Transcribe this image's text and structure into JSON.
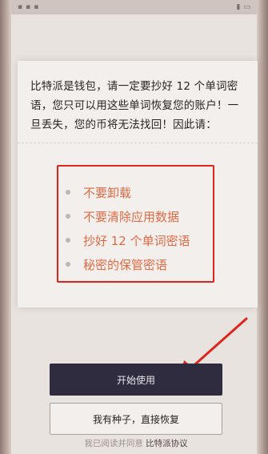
{
  "intro": {
    "text": "比特派是钱包，请一定要抄好 12 个单词密语，您只可以用这些单词恢复您的账户！一旦丢失，您的币将无法找回！因此请："
  },
  "tips": [
    "不要卸载",
    "不要清除应用数据",
    "抄好 12 个单词密语",
    "秘密的保管密语"
  ],
  "buttons": {
    "start": "开始使用",
    "restore": "我有种子，直接恢复"
  },
  "agreement": {
    "prefix": "我已阅读并同意",
    "link": "比特派协议"
  },
  "colors": {
    "highlight_box": "#e0241b",
    "tip_text": "#e26a45",
    "primary_button": "#2f2c40"
  }
}
